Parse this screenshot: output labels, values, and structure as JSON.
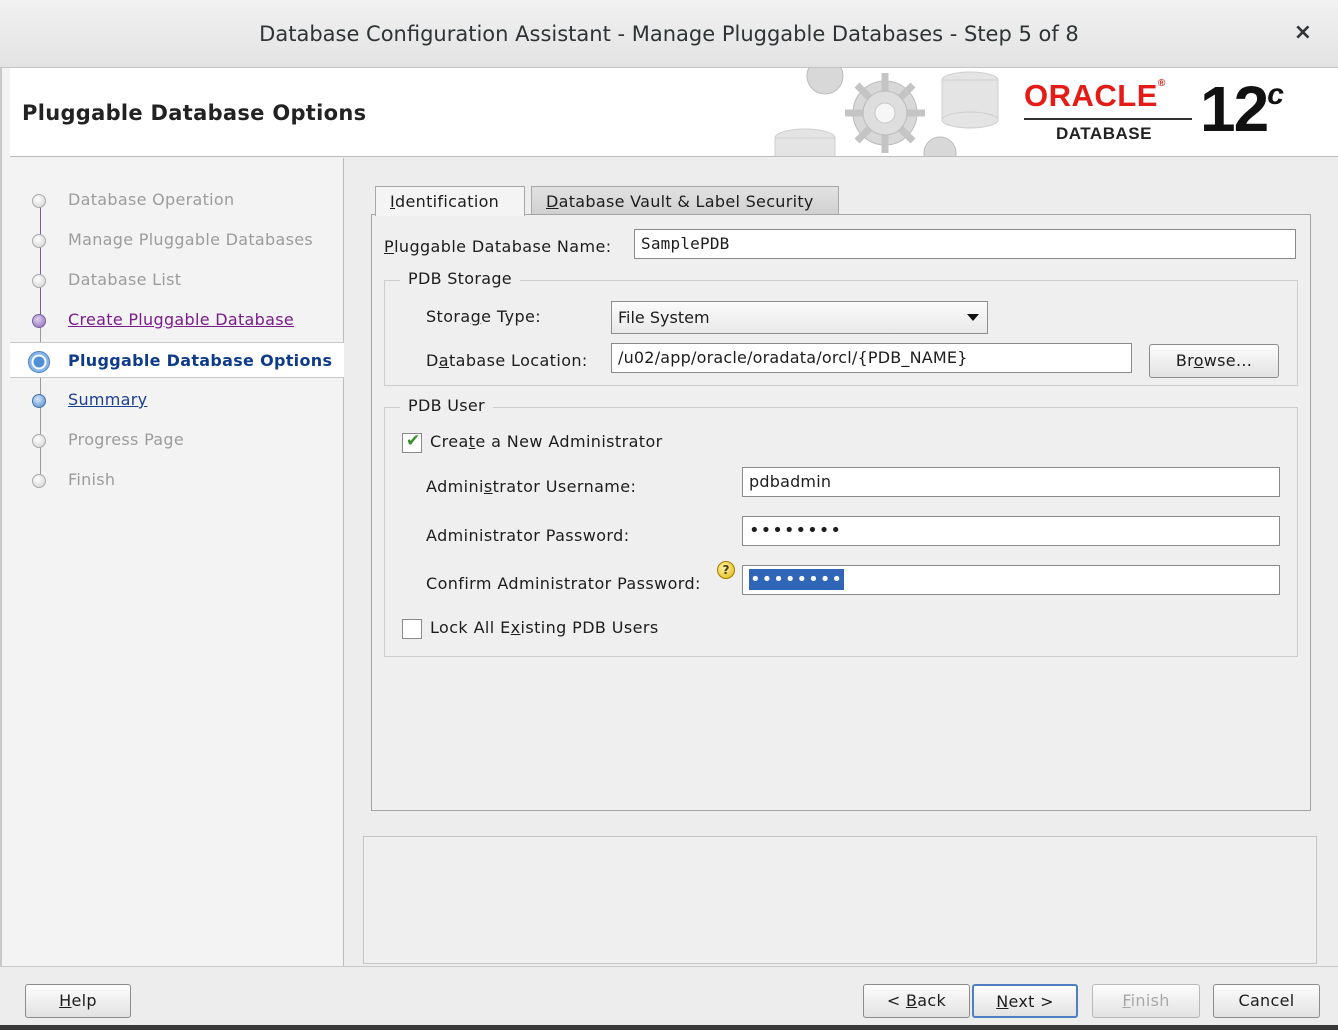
{
  "window": {
    "title": "Database Configuration Assistant - Manage Pluggable Databases - Step 5 of 8",
    "close_glyph": "×"
  },
  "header": {
    "page_title": "Pluggable Database Options",
    "logo": {
      "brand": "ORACLE",
      "product": "DATABASE",
      "version": "12",
      "version_suffix": "c"
    }
  },
  "sidebar": {
    "steps": [
      {
        "label": "Database Operation",
        "state": "disabled"
      },
      {
        "label": "Manage Pluggable Databases",
        "state": "disabled"
      },
      {
        "label": "Database List",
        "state": "disabled"
      },
      {
        "label": "Create Pluggable Database",
        "state": "visited"
      },
      {
        "label": "Pluggable Database Options",
        "state": "current"
      },
      {
        "label": "Summary",
        "state": "link"
      },
      {
        "label": "Progress Page",
        "state": "disabled"
      },
      {
        "label": "Finish",
        "state": "disabled"
      }
    ]
  },
  "tabs": [
    {
      "label": "Identification",
      "mnemonic": "I",
      "rest": "dentification",
      "active": true
    },
    {
      "label": "Database Vault & Label Security",
      "mnemonic": "D",
      "rest": "atabase Vault & Label Security",
      "active": false
    }
  ],
  "form": {
    "pdb_name_label_pre": "",
    "pdb_name_label_m": "P",
    "pdb_name_label_post": "luggable Database Name:",
    "pdb_name_value": "SamplePDB",
    "storage_group_title": "PDB Storage",
    "storage_type_label_pre": "Stora",
    "storage_type_label_m": "g",
    "storage_type_label_post": "e Type:",
    "storage_type_value": "File System",
    "db_location_label_pre": "D",
    "db_location_label_m": "a",
    "db_location_label_post": "tabase Location:",
    "db_location_value": "/u02/app/oracle/oradata/orcl/{PDB_NAME}",
    "browse_pre": "Br",
    "browse_m": "o",
    "browse_post": "wse...",
    "user_group_title": "PDB User",
    "create_admin_pre": "Crea",
    "create_admin_m": "t",
    "create_admin_post": "e a New Administrator",
    "create_admin_checked": true,
    "admin_user_label_pre": "Admini",
    "admin_user_label_m": "s",
    "admin_user_label_post": "trator Username:",
    "admin_user_value": "pdbadmin",
    "admin_pwd_label": "Administrator Password:",
    "admin_pwd_value": "••••••••",
    "confirm_pwd_label": "Confirm Administrator Password:",
    "confirm_pwd_value": "••••••••",
    "lock_users_pre": "Lock All E",
    "lock_users_m": "x",
    "lock_users_post": "isting PDB Users",
    "lock_users_checked": false
  },
  "footer": {
    "help_m": "H",
    "help_post": "elp",
    "back_pre": "< ",
    "back_m": "B",
    "back_post": "ack",
    "next_m": "N",
    "next_post": "ext >",
    "finish_m": "F",
    "finish_post": "inish",
    "cancel": "Cancel"
  },
  "colors": {
    "accent": "#0f3c8a",
    "visited": "#7a1c8a",
    "oracle_red": "#e41b17",
    "selection": "#2f66b7"
  }
}
